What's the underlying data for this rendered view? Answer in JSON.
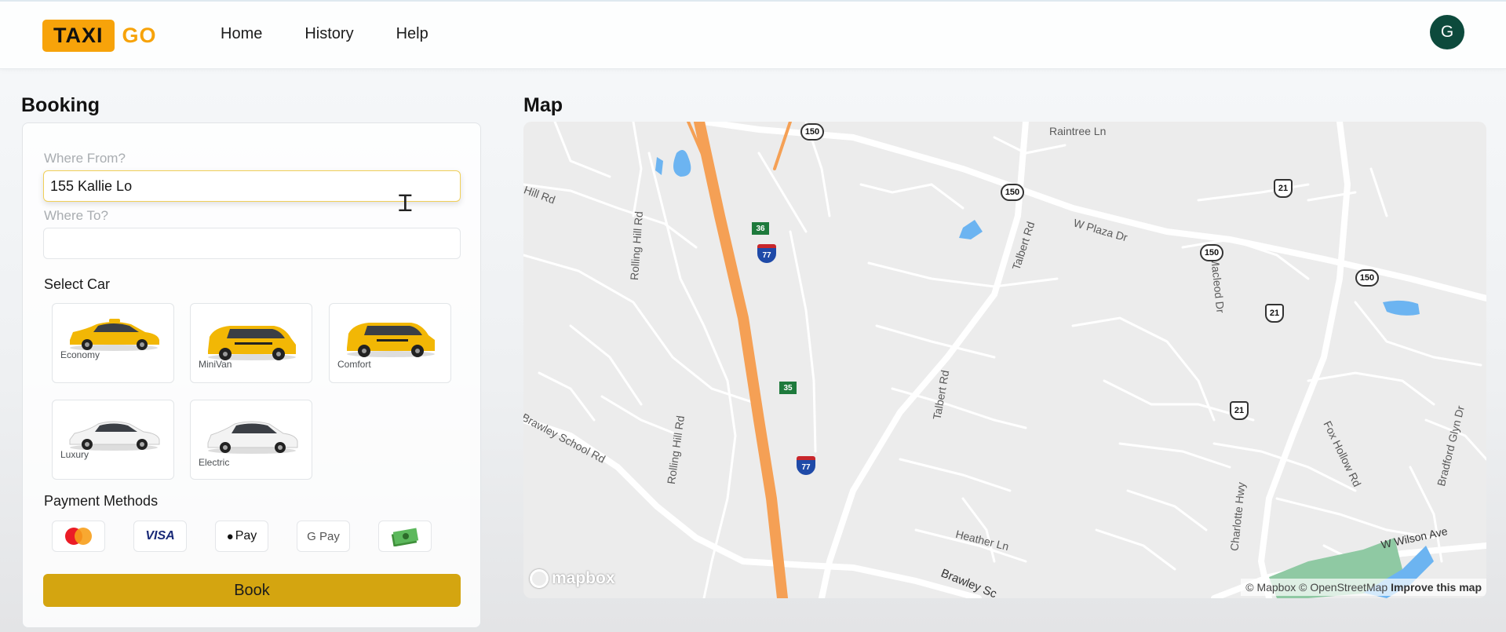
{
  "header": {
    "logo_taxi": "TAXI",
    "logo_go": "GO",
    "nav": [
      "Home",
      "History",
      "Help"
    ],
    "avatar_initial": "G"
  },
  "booking": {
    "title": "Booking",
    "from_label": "Where From?",
    "from_value": "155 Kallie Lo",
    "to_label": "Where To?",
    "to_value": "",
    "select_car_label": "Select Car",
    "cars": [
      {
        "name": "Economy",
        "color": "#f2b705"
      },
      {
        "name": "MiniVan",
        "color": "#f2b705"
      },
      {
        "name": "Comfort",
        "color": "#f2b705"
      },
      {
        "name": "Luxury",
        "color": "#f1f1f1"
      },
      {
        "name": "Electric",
        "color": "#f1f1f1"
      }
    ],
    "payment_label": "Payment Methods",
    "payment_methods": [
      "mastercard-icon",
      "VISA",
      "Pay",
      "G Pay",
      "cash-icon"
    ],
    "book_label": "Book"
  },
  "map": {
    "title": "Map",
    "roads": [
      "Raintree Ln",
      "Hill Rd",
      "W Plaza Dr",
      "Talbert Rd",
      "Rolling Hill Rd",
      "Macleod Dr",
      "Brawley School Rd",
      "Rolling Hill Rd",
      "Talbert Rd",
      "Charlotte Hwy",
      "Fox Hollow Rd",
      "Bradford Glyn Dr",
      "Heather Ln",
      "Brawley Sc",
      "W Wilson Ave"
    ],
    "shields_150": [
      "150",
      "150",
      "150",
      "150"
    ],
    "shields_21": [
      "21",
      "21",
      "21"
    ],
    "exits": [
      "36",
      "35"
    ],
    "interstate": [
      "77",
      "77"
    ],
    "mapbox_logo": "mapbox",
    "attribution_mapbox": "© Mapbox",
    "attribution_osm": "© OpenStreetMap",
    "attribution_improve": "Improve this map"
  }
}
